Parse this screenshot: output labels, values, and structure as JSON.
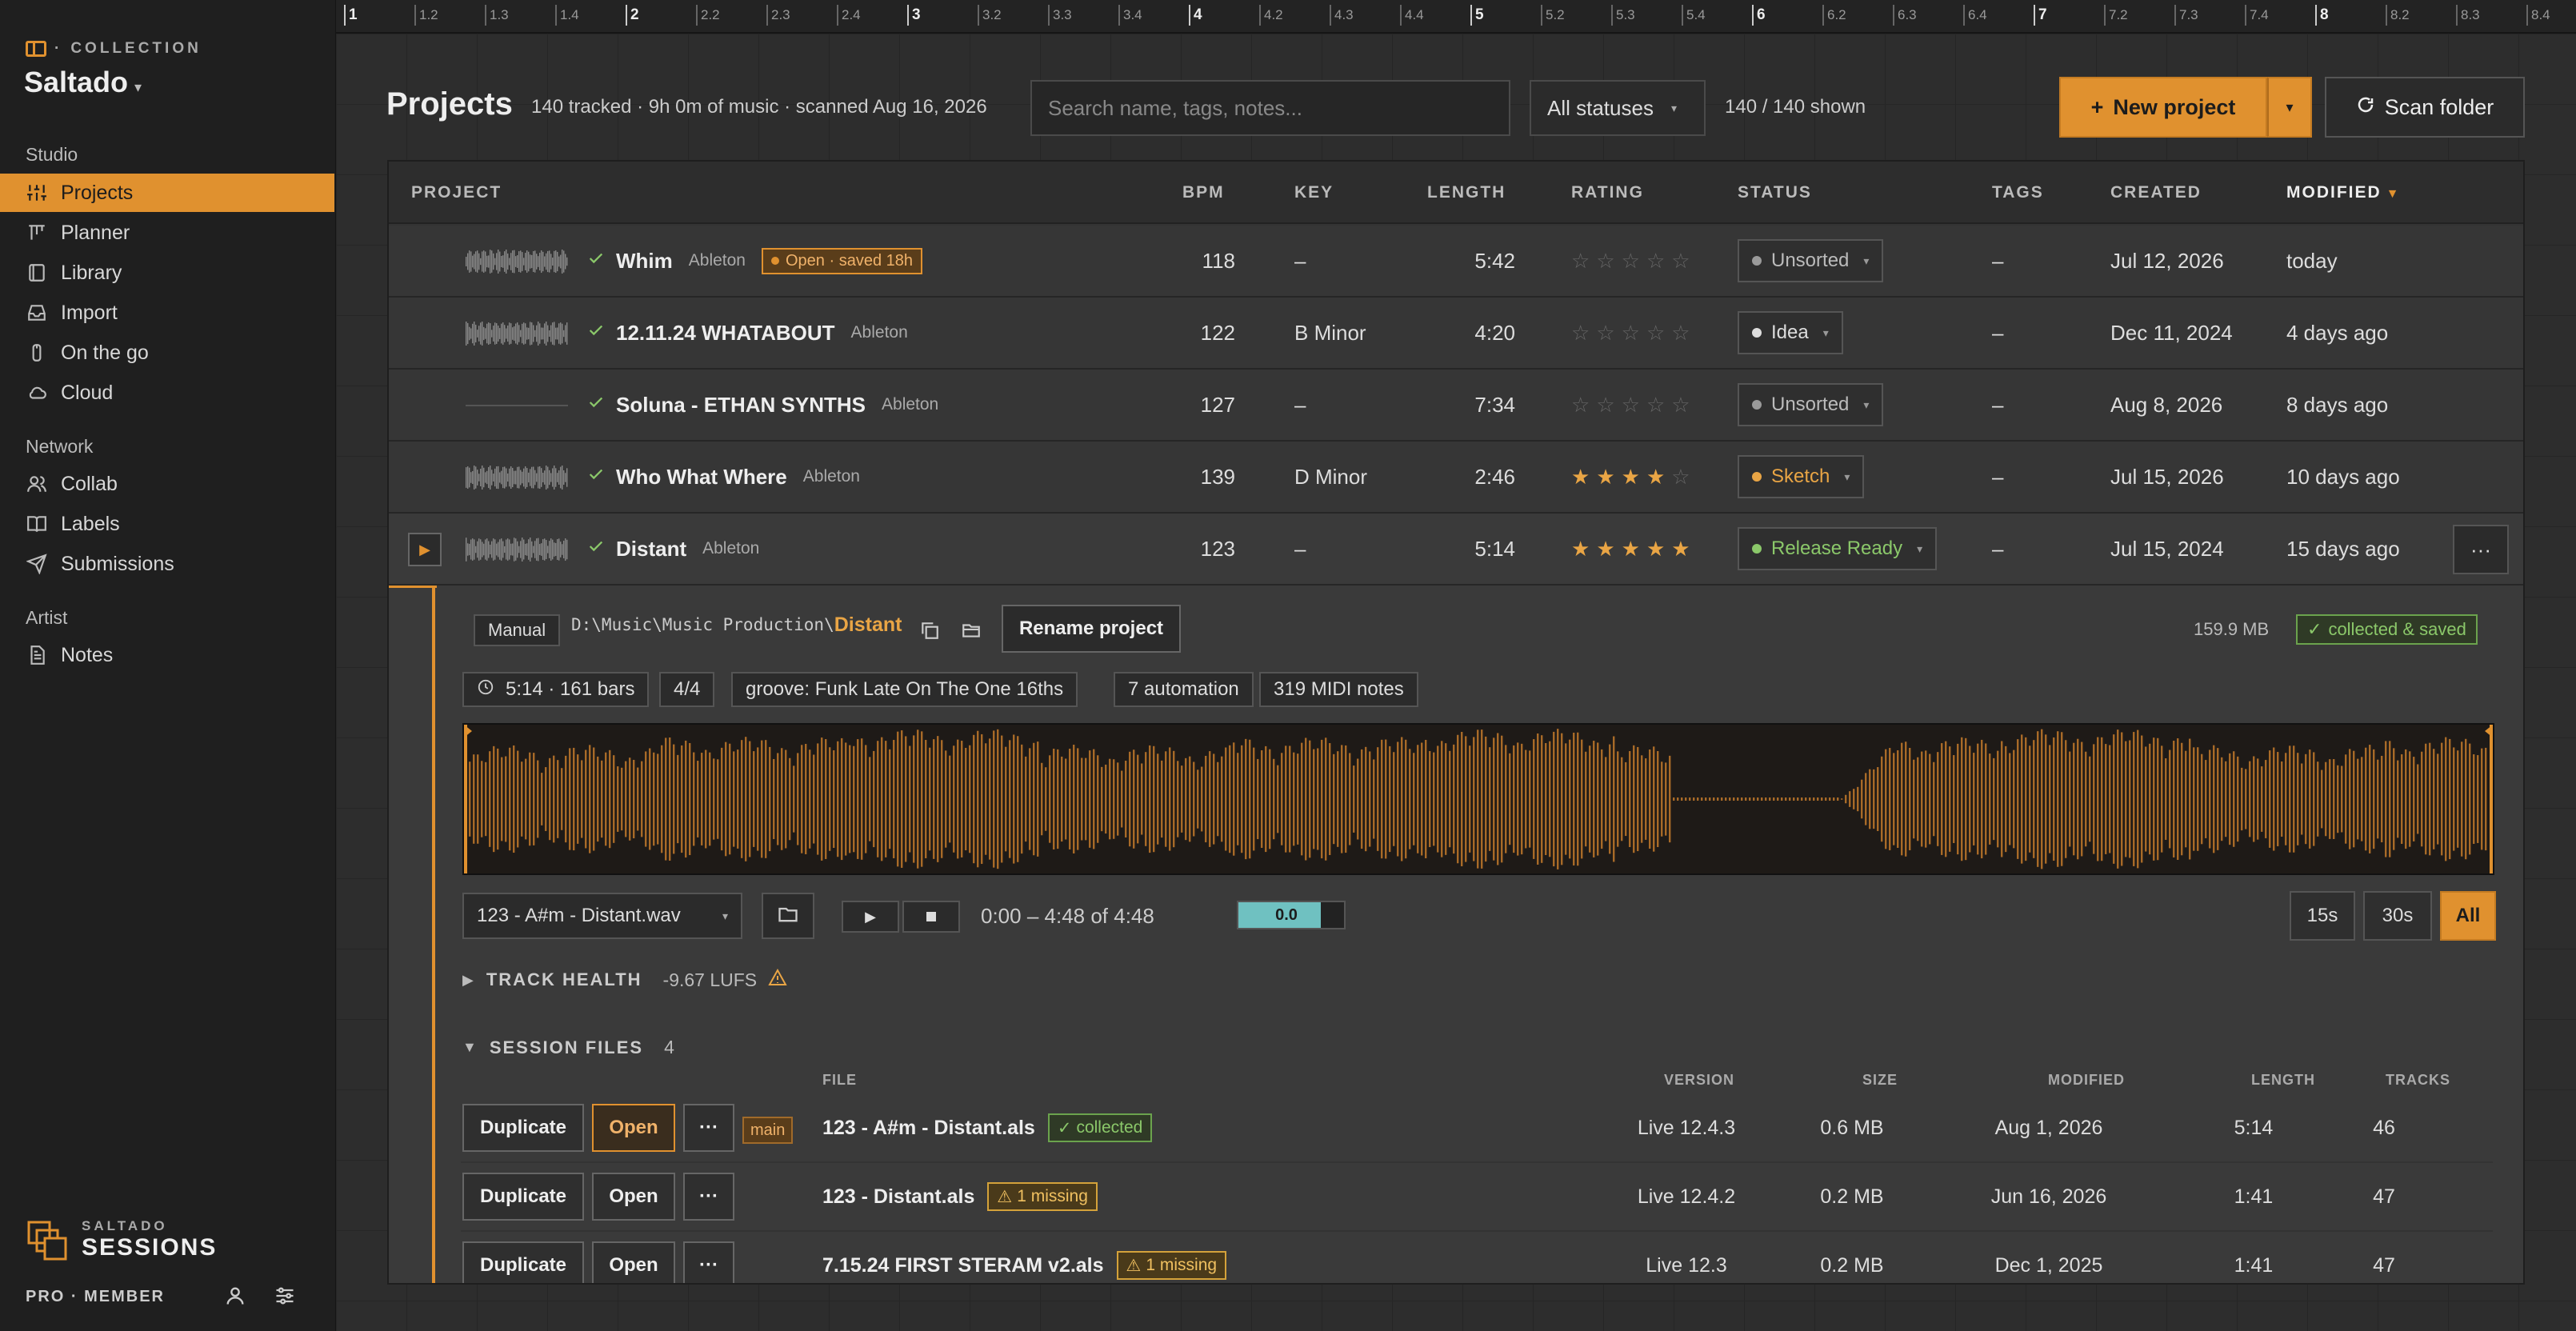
{
  "sidebar": {
    "collection_label": "COLLECTION",
    "workspace": "Saltado",
    "sections": [
      {
        "title": "Studio",
        "items": [
          {
            "label": "Projects",
            "icon": "sliders-icon",
            "active": true
          },
          {
            "label": "Planner",
            "icon": "planner-icon"
          },
          {
            "label": "Library",
            "icon": "book-icon"
          },
          {
            "label": "Import",
            "icon": "inbox-icon"
          },
          {
            "label": "On the go",
            "icon": "phone-icon"
          },
          {
            "label": "Cloud",
            "icon": "cloud-icon"
          }
        ]
      },
      {
        "title": "Network",
        "items": [
          {
            "label": "Collab",
            "icon": "users-icon"
          },
          {
            "label": "Labels",
            "icon": "open-book-icon"
          },
          {
            "label": "Submissions",
            "icon": "send-icon"
          }
        ]
      },
      {
        "title": "Artist",
        "items": [
          {
            "label": "Notes",
            "icon": "note-icon"
          }
        ]
      }
    ],
    "brand_top": "SALTADO",
    "brand_bottom": "SESSIONS",
    "member": "PRO · MEMBER"
  },
  "ruler": {
    "labels": [
      "1",
      "1.2",
      "1.3",
      "1.4",
      "2",
      "2.2",
      "2.3",
      "2.4",
      "3",
      "3.2",
      "3.3",
      "3.4",
      "4",
      "4.2",
      "4.3",
      "4.4",
      "5",
      "5.2",
      "5.3",
      "5.4",
      "6",
      "6.2",
      "6.3",
      "6.4",
      "7",
      "7.2",
      "7.3",
      "7.4",
      "8",
      "8.2",
      "8.3",
      "8.4"
    ]
  },
  "header": {
    "title": "Projects",
    "subtitle": "140 tracked · 9h 0m of music · scanned Aug 16, 2026",
    "search_placeholder": "Search name, tags, notes...",
    "status_filter": "All statuses",
    "shown": "140 / 140 shown",
    "new_project": "New project",
    "scan_folder": "Scan folder"
  },
  "table": {
    "columns": {
      "project": "PROJECT",
      "bpm": "BPM",
      "key": "KEY",
      "length": "LENGTH",
      "rating": "RATING",
      "status": "STATUS",
      "tags": "TAGS",
      "created": "CREATED",
      "modified": "MODIFIED"
    },
    "rows": [
      {
        "name": "Whim",
        "daw": "Ableton",
        "badge": "Open · saved 18h",
        "bpm": "118",
        "key": "–",
        "length": "5:42",
        "rating": 0,
        "status": "Unsorted",
        "status_color": "#9a9a9a",
        "tags": "–",
        "created": "Jul 12, 2026",
        "modified": "today"
      },
      {
        "name": "12.11.24 WHATABOUT",
        "daw": "Ableton",
        "bpm": "122",
        "key": "B Minor",
        "length": "4:20",
        "rating": 0,
        "status": "Idea",
        "status_color": "#dddddd",
        "tags": "–",
        "created": "Dec 11, 2024",
        "modified": "4 days ago"
      },
      {
        "name": "Soluna - ETHAN SYNTHS",
        "daw": "Ableton",
        "bpm": "127",
        "key": "–",
        "length": "7:34",
        "rating": 0,
        "status": "Unsorted",
        "status_color": "#9a9a9a",
        "tags": "–",
        "created": "Aug 8, 2026",
        "modified": "8 days ago"
      },
      {
        "name": "Who What Where",
        "daw": "Ableton",
        "bpm": "139",
        "key": "D Minor",
        "length": "2:46",
        "rating": 4,
        "status": "Sketch",
        "status_color": "#e9a545",
        "tags": "–",
        "created": "Jul 15, 2026",
        "modified": "10 days ago"
      },
      {
        "name": "Distant",
        "daw": "Ableton",
        "bpm": "123",
        "key": "–",
        "length": "5:14",
        "rating": 5,
        "status": "Release Ready",
        "status_color": "#8bc86a",
        "tags": "–",
        "created": "Jul 15, 2024",
        "modified": "15 days ago"
      }
    ]
  },
  "detail": {
    "mode": "Manual",
    "path_prefix": "D:\\Music\\Music Production\\",
    "path_name": "Distant",
    "rename": "Rename project",
    "size": "159.9 MB",
    "collected": "collected & saved",
    "chips": [
      "5:14 · 161 bars",
      "4/4",
      "groove: Funk Late On The One 16ths",
      "7 automation",
      "319 MIDI notes"
    ],
    "audio_file": "123 - A#m - Distant.wav",
    "time_range": "0:00 – 4:48 of 4:48",
    "meter_value": "0.0",
    "meter_level": 0.78,
    "ranges": [
      "15s",
      "30s",
      "All"
    ],
    "track_health_label": "TRACK HEALTH",
    "lufs": "-9.67 LUFS",
    "session_files_label": "SESSION FILES",
    "session_files_count": "4",
    "file_columns": {
      "file": "FILE",
      "version": "VERSION",
      "size": "SIZE",
      "modified": "MODIFIED",
      "length": "LENGTH",
      "tracks": "TRACKS"
    },
    "buttons": {
      "duplicate": "Duplicate",
      "open": "Open",
      "more": "···",
      "main": "main"
    },
    "files": [
      {
        "name": "123 - A#m - Distant.als",
        "badge": "collected",
        "badge_type": "ok",
        "version": "Live 12.4.3",
        "size": "0.6 MB",
        "modified": "Aug 1, 2026",
        "length": "5:14",
        "tracks": "46"
      },
      {
        "name": "123 - Distant.als",
        "badge": "1 missing",
        "badge_type": "miss",
        "version": "Live 12.4.2",
        "size": "0.2 MB",
        "modified": "Jun 16, 2026",
        "length": "1:41",
        "tracks": "47"
      },
      {
        "name": "7.15.24 FIRST STERAM v2.als",
        "badge": "1 missing",
        "badge_type": "miss",
        "version": "Live 12.3",
        "size": "0.2 MB",
        "modified": "Dec 1, 2025",
        "length": "1:41",
        "tracks": "47"
      }
    ]
  },
  "colors": {
    "accent": "#e0912f",
    "ok": "#8bc86a",
    "warn": "#f0c060",
    "meter": "#6fc1c1"
  }
}
